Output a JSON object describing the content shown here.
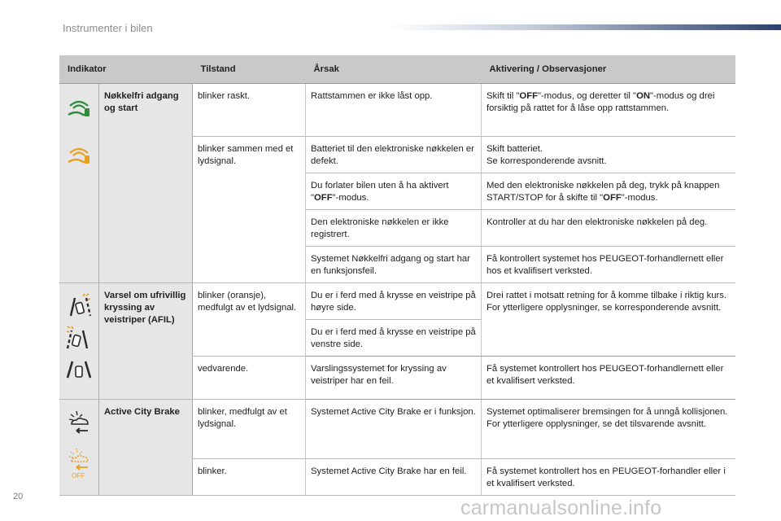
{
  "page": {
    "header": "Instrumenter i bilen",
    "page_number": "20",
    "watermark": "carmanualsonline.info"
  },
  "table": {
    "headers": {
      "indicator": "Indikator",
      "state": "Tilstand",
      "cause": "Årsak",
      "action": "Aktivering / Observasjoner"
    },
    "keyless": {
      "name": "Nøkkelfri adgang og start",
      "icons": [
        "keyless-green-icon",
        "keyless-orange-icon"
      ],
      "row1": {
        "state": "blinker raskt.",
        "cause": "Rattstammen er ikke låst opp.",
        "action_a": "Skift til \"",
        "action_b": "OFF",
        "action_c": "\"-modus, og deretter til \"",
        "action_d": "ON",
        "action_e": "\"-modus og drei forsiktig på rattet for å låse opp rattstammen."
      },
      "row2": {
        "state": "blinker sammen med et lydsignal.",
        "cause": "Batteriet til den elektroniske nøkkelen er defekt.",
        "action_line1": "Skift batteriet.",
        "action_line2": "Se korresponderende avsnitt."
      },
      "row3": {
        "cause_a": "Du forlater bilen uten å ha aktivert \"",
        "cause_b": "OFF",
        "cause_c": "\"-modus.",
        "action_a": "Med den elektroniske nøkkelen på deg, trykk på knappen START/STOP for å skifte til \"",
        "action_b": "OFF",
        "action_c": "\"-modus."
      },
      "row4": {
        "cause": "Den elektroniske nøkkelen er ikke registrert.",
        "action": "Kontroller at du har den elektroniske nøkkelen på deg."
      },
      "row5": {
        "cause": "Systemet Nøkkelfri adgang og start har en funksjonsfeil.",
        "action": "Få kontrollert systemet hos PEUGEOT-forhandlernett eller hos et kvalifisert verksted."
      }
    },
    "afil": {
      "name": "Varsel om ufrivillig kryssing av veistriper (AFIL)",
      "icons": [
        "lane-right-icon",
        "lane-left-icon",
        "lane-fault-icon"
      ],
      "row1": {
        "state": "blinker (oransje), medfulgt av et lydsignal.",
        "cause": "Du er i ferd med å krysse en veistripe på høyre side.",
        "action_line1": "Drei rattet i motsatt retning for å komme tilbake i riktig kurs.",
        "action_line2": "For ytterligere opplysninger, se korresponderende avsnitt."
      },
      "row2": {
        "cause": "Du er i ferd med å krysse en veistripe på venstre side."
      },
      "row3": {
        "state": "vedvarende.",
        "cause": "Varslingssystemet for kryssing av veistriper har en feil.",
        "action": "Få systemet kontrollert hos PEUGEOT-forhandlernett eller et kvalifisert verksted."
      }
    },
    "acb": {
      "name": "Active City Brake",
      "icons": [
        "active-city-brake-icon",
        "active-city-brake-off-icon"
      ],
      "off_label": "OFF",
      "row1": {
        "state": "blinker, medfulgt av et lydsignal.",
        "cause": "Systemet Active City Brake er i funksjon.",
        "action_line1": "Systemet optimaliserer bremsingen for å unngå kollisjonen.",
        "action_line2": "For ytterligere opplysninger, se det tilsvarende avsnitt."
      },
      "row2": {
        "state": "blinker.",
        "cause": "Systemet Active City Brake har en feil.",
        "action": "Få systemet kontrollert hos en PEUGEOT-forhandler eller i et kvalifisert verksted."
      }
    }
  },
  "colors": {
    "header_bg": "#c9c9c9",
    "indicator_bg": "#e6e6e6",
    "green": "#2e8b3a",
    "orange": "#e8a020"
  }
}
